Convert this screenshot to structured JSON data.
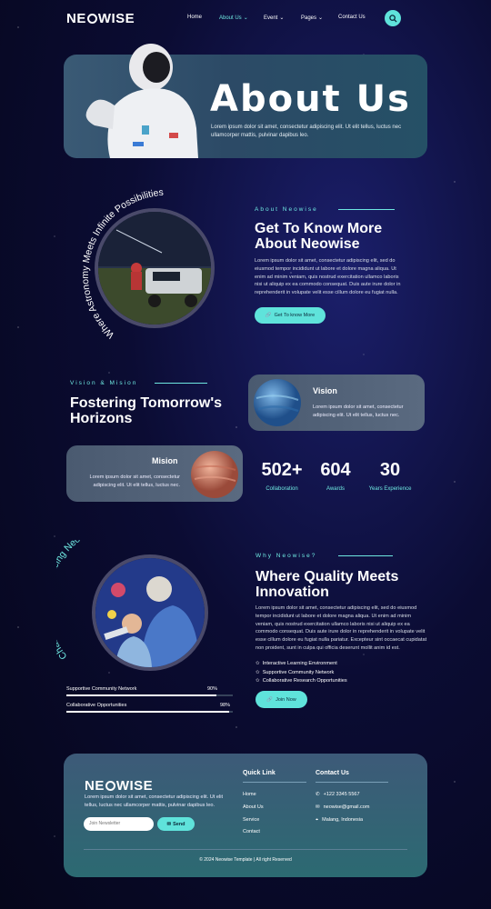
{
  "brand": {
    "logo_text_1": "NE",
    "logo_text_2": "WISE"
  },
  "nav": {
    "items": [
      {
        "label": "Home"
      },
      {
        "label": "About Us"
      },
      {
        "label": "Event"
      },
      {
        "label": "Pages"
      },
      {
        "label": "Contact Us"
      }
    ]
  },
  "hero": {
    "title": "About Us",
    "subtitle": "Lorem ipsum dolor sit amet, consectetur adipiscing elit. Ut elit tellus, luctus nec ullamcorper mattis, pulvinar dapibus leo."
  },
  "about": {
    "curved_text": "Where Astronomy Meets Infinite Possibilities",
    "kicker": "About Neowise",
    "title_line1": "Get To Know More",
    "title_line2": "About Neowise",
    "body": "Lorem ipsum dolor sit amet, consectetur adipiscing elit, sed do eiusmod tempor incididunt ut labore et dolore magna aliqua. Ut enim ad minim veniam, quis nostrud exercitation ullamco laboris nisi ut aliquip ex ea commodo consequat. Duis aute irure dolor in reprehenderit in volupate velit esse cillum dolore eu fugiat nulla.",
    "button": "Get To know More"
  },
  "vision_mission": {
    "kicker": "Vision & Mision",
    "title_line1": "Fostering Tomorrow's",
    "title_line2": "Horizons",
    "vision_title": "Vision",
    "vision_body": "Lorem ipsum dolor sit amet, consectetur adipiscing elit. Ut elit tellus, luctus nec.",
    "mission_title": "Mision",
    "mission_body": "Lorem ipsum dolor sit amet, consectetur adipiscing elit. Ut elit tellus, luctus nec.",
    "stats": [
      {
        "value": "502+",
        "label": "Collaboration"
      },
      {
        "value": "604",
        "label": "Awards"
      },
      {
        "value": "30",
        "label": "Years Experience"
      }
    ]
  },
  "why": {
    "curved_text": "Chasing Stars, Embracing Neowise Wonders",
    "kicker": "Why Neowise?",
    "title_line1": "Where Quality Meets",
    "title_line2": "Innovation",
    "body": "Lorem ipsum dolor sit amet, consectetur adipiscing elit, sed do eiusmod tempor incididunt ut labore et dolore magna aliqua. Ut enim ad minim veniam, quis nostrud exercitation ullamco laboris nisi ut aliquip ex ea commodo consequat. Duis aute irure dolor in reprehenderit in volupate velit esse cillum dolore eu fugiat nulla pariatur. Excepteur sint occaecat cupidatat non proident, sunt in culpa qui officia deserunt mollit anim id est.",
    "features": [
      "Interactive Learning Environment",
      "Supportive Community Network",
      "Collaborative Research Opportunities"
    ],
    "button": "Join Now",
    "progress": [
      {
        "label": "Supportive Community Network",
        "value_text": "90%",
        "value": 0.9
      },
      {
        "label": "Collaborative Opportunities",
        "value_text": "98%",
        "value": 0.98
      }
    ]
  },
  "footer": {
    "logo_text_1": "NE",
    "logo_text_2": "WISE",
    "about": "Lorem ipsum dolor sit amet, consectetur adipiscing elit. Ut elit tellus, luctus nec ullamcorper mattis, pulvinar dapibus leo.",
    "newsletter_placeholder": "Join Newsletter",
    "send": "Send",
    "quick_link_title": "Quick Link",
    "quick_links": [
      "Home",
      "About Us",
      "Service",
      "Contact"
    ],
    "contact_title": "Contact Us",
    "phone": "+122 3345 5567",
    "email": "neowise@gmail.com",
    "address": "Malang, Indonesia",
    "copyright": "© 2024 Neowise Template | All right Reserved"
  },
  "colors": {
    "accent": "#5fe3db",
    "background": "#0b0c33"
  }
}
